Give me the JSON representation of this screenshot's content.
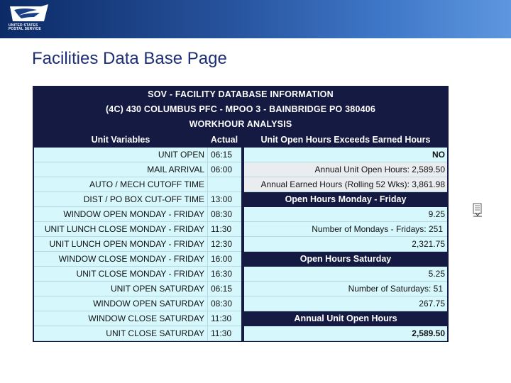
{
  "header": {
    "logo_text_line1": "UNITED STATES",
    "logo_text_line2": "POSTAL SERVICE"
  },
  "page_title": "Facilities Data Base Page",
  "table": {
    "title_lines": [
      "SOV - FACILITY DATABASE INFORMATION",
      "(4C) 430 COLUMBUS PFC  -  MPOO 3  -  BAINBRIDGE PO 380406",
      "WORKHOUR ANALYSIS"
    ],
    "left_headers": {
      "variable": "Unit Variables",
      "actual": "Actual"
    },
    "left_rows": [
      {
        "label": "UNIT OPEN",
        "value": "06:15"
      },
      {
        "label": "MAIL ARRIVAL",
        "value": "06:00"
      },
      {
        "label": "AUTO / MECH CUTOFF TIME",
        "value": ""
      },
      {
        "label": "DIST / PO BOX CUT-OFF TIME",
        "value": "13:00"
      },
      {
        "label": "WINDOW OPEN MONDAY - FRIDAY",
        "value": "08:30"
      },
      {
        "label": "UNIT LUNCH CLOSE MONDAY - FRIDAY",
        "value": "11:30"
      },
      {
        "label": "UNIT LUNCH OPEN MONDAY - FRIDAY",
        "value": "12:30"
      },
      {
        "label": "WINDOW CLOSE MONDAY - FRIDAY",
        "value": "16:00"
      },
      {
        "label": "UNIT CLOSE MONDAY - FRIDAY",
        "value": "16:30"
      },
      {
        "label": "UNIT OPEN SATURDAY",
        "value": "06:15"
      },
      {
        "label": "WINDOW OPEN SATURDAY",
        "value": "08:30"
      },
      {
        "label": "WINDOW CLOSE SATURDAY",
        "value": "11:30"
      },
      {
        "label": "UNIT CLOSE SATURDAY",
        "value": "11:30"
      }
    ],
    "right": {
      "head1": "Unit Open Hours Exceeds Earned Hours",
      "exceeds_value": "NO",
      "annual_open_label": "Annual Unit Open Hours:",
      "annual_open_value": "2,589.50",
      "annual_earned_label": "Annual Earned Hours (Rolling 52 Wks):",
      "annual_earned_value": "3,861.98",
      "head2": "Open Hours Monday - Friday",
      "mf_hours": "9.25",
      "mondays_label": "Number of Mondays - Fridays:",
      "mondays_value": "251",
      "mf_total": "2,321.75",
      "head3": "Open Hours Saturday",
      "sat_hours": "5.25",
      "saturdays_label": "Number of Saturdays:",
      "saturdays_value": "51",
      "sat_total": "267.75",
      "head4": "Annual Unit Open Hours",
      "annual_total": "2,589.50"
    }
  },
  "colors": {
    "banner_dark": "#0c2a66",
    "banner_light": "#5e97de",
    "table_header": "#151a42",
    "cell_bg": "#d6f8fd",
    "title_color": "#1e2f75"
  },
  "icons": [
    "eagle-logo-icon",
    "document-download-icon"
  ]
}
